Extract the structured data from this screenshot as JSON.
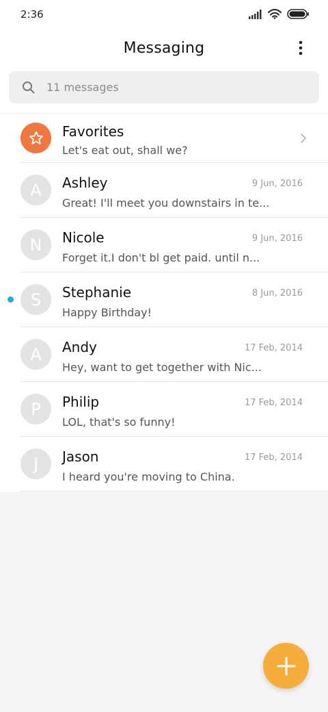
{
  "status_bar": {
    "time": "2:36",
    "icons": [
      "signal-icon",
      "wifi-icon",
      "battery-icon"
    ]
  },
  "header": {
    "title": "Messaging",
    "menu_icon": "more-vertical-icon"
  },
  "search": {
    "placeholder": "11 messages",
    "icon": "search-icon"
  },
  "favorites": {
    "name": "Favorites",
    "preview": "Let's eat out, shall we?",
    "icon": "star-icon"
  },
  "conversations": [
    {
      "initial": "A",
      "name": "Ashley",
      "date": "9 Jun, 2016",
      "preview": "Great! I'll meet you downstairs in te...",
      "unread": false
    },
    {
      "initial": "N",
      "name": "Nicole",
      "date": "9 Jun, 2016",
      "preview": "Forget it.I don't bl get paid. until n...",
      "unread": false
    },
    {
      "initial": "S",
      "name": "Stephanie",
      "date": "8 Jun, 2016",
      "preview": "Happy Birthday!",
      "unread": true
    },
    {
      "initial": "A",
      "name": "Andy",
      "date": "17 Feb, 2014",
      "preview": "Hey, want to get together with Nic...",
      "unread": false
    },
    {
      "initial": "P",
      "name": "Philip",
      "date": "17 Feb, 2014",
      "preview": "LOL, that's so funny!",
      "unread": false
    },
    {
      "initial": "J",
      "name": "Jason",
      "date": "17 Feb, 2014",
      "preview": "I heard you're moving to China.",
      "unread": false
    }
  ],
  "colors": {
    "favorites_avatar": "#f07840",
    "avatar_default": "#e3e3e3",
    "unread_dot": "#2aa7e8",
    "fab": "#f6ad3c"
  },
  "fab": {
    "icon": "plus-icon"
  }
}
